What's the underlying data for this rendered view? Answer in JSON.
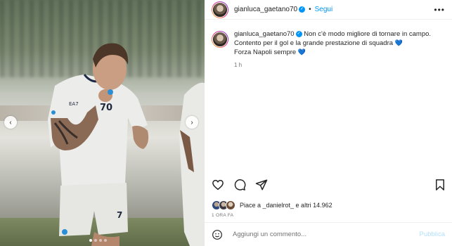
{
  "header": {
    "username": "gianluca_gaetano70",
    "separator": "•",
    "follow_label": "Segui",
    "more_icon": "more-horizontal-icon"
  },
  "caption": {
    "username": "gianluca_gaetano70",
    "line1": "Non c'è modo migliore di tornare in campo.",
    "line2": "Contento per il gol e la grande prestazione di squadra",
    "line3": "Forza Napoli sempre",
    "heart": "💙",
    "time": "1 h"
  },
  "media": {
    "jersey_number": "70",
    "shorts_number": "7",
    "carousel_dots": 4,
    "active_dot": 0
  },
  "likes": {
    "text": "Piace a _danielrot_ e altri 14.962"
  },
  "date": "1 ORA FA",
  "comment": {
    "placeholder": "Aggiungi un commento...",
    "publish_label": "Pubblica"
  },
  "colors": {
    "link_blue": "#0095f6",
    "publish_disabled": "#b2dffc",
    "text": "#262626",
    "muted": "#737373"
  }
}
